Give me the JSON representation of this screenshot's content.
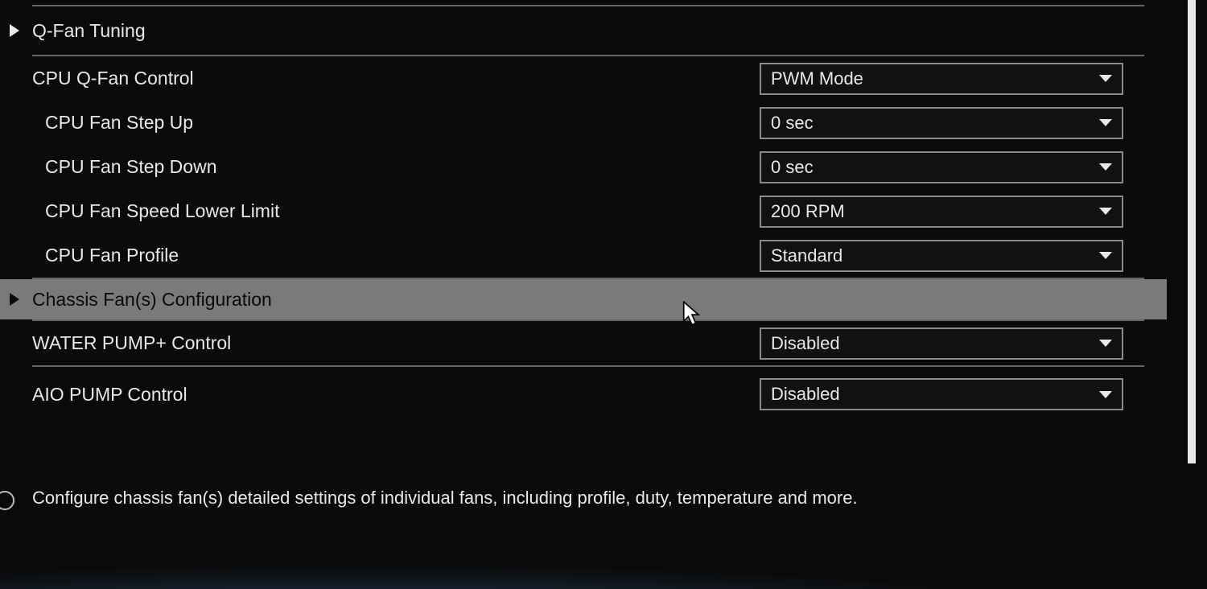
{
  "menu": {
    "qfan_tuning": "Q-Fan Tuning",
    "chassis_fan_config": "Chassis Fan(s) Configuration"
  },
  "settings": {
    "cpu_qfan_control": {
      "label": "CPU Q-Fan Control",
      "value": "PWM Mode"
    },
    "cpu_fan_step_up": {
      "label": "CPU Fan Step Up",
      "value": "0 sec"
    },
    "cpu_fan_step_down": {
      "label": "CPU Fan Step Down",
      "value": "0 sec"
    },
    "cpu_fan_speed_lower_limit": {
      "label": "CPU Fan Speed Lower Limit",
      "value": "200 RPM"
    },
    "cpu_fan_profile": {
      "label": "CPU Fan Profile",
      "value": "Standard"
    },
    "water_pump_control": {
      "label": "WATER PUMP+ Control",
      "value": "Disabled"
    },
    "aio_pump_control": {
      "label": "AIO PUMP Control",
      "value": "Disabled"
    }
  },
  "help": {
    "text": "Configure chassis fan(s) detailed settings of individual fans, including profile, duty, temperature and more."
  }
}
